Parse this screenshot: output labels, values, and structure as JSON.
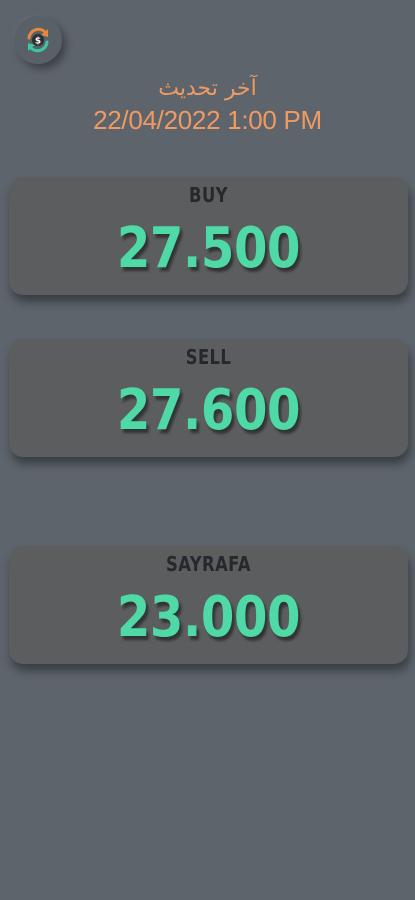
{
  "header": {
    "refresh_icon": "currency-refresh-icon",
    "update_label": "آخر تحديث",
    "update_date": "22/04/2022 1:00 PM"
  },
  "rates": [
    {
      "label": "BUY",
      "value": "27.500"
    },
    {
      "label": "SELL",
      "value": "27.600"
    },
    {
      "label": "SAYRAFA",
      "value": "23.000"
    }
  ],
  "colors": {
    "background": "#5d646c",
    "card": "#5c5d5f",
    "accent_orange": "#f09a62",
    "value_green": "#4fd9a6"
  }
}
